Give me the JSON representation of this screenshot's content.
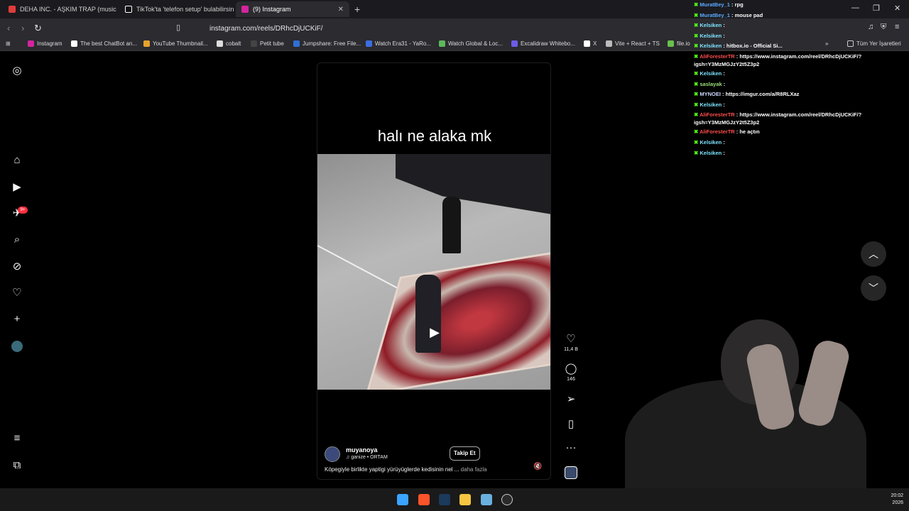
{
  "browser": {
    "tabs": [
      {
        "title": "DEHA INC. - AŞKIM TRAP (music vide",
        "color": "#e03c3c"
      },
      {
        "title": "TikTok'ta 'telefon setup' bulabilirsiniz",
        "color": "#ffffff"
      },
      {
        "title": "(9) Instagram",
        "color": "#d6249f",
        "active": true
      }
    ],
    "new_tab": "+",
    "url": "instagram.com/reels/DRhcDjUCKiF/",
    "bookmarks": [
      {
        "label": "Instagram",
        "color": "#d6249f"
      },
      {
        "label": "The best ChatBot an...",
        "color": "#ffffff"
      },
      {
        "label": "YouTube Thumbnail...",
        "color": "#e6a22d"
      },
      {
        "label": "cobalt",
        "color": "#ffffff"
      },
      {
        "label": "Petit tube",
        "color": "#444444"
      },
      {
        "label": "Jumpshare: Free File...",
        "color": "#2f6fd6"
      },
      {
        "label": "Watch Era31 - YaRo...",
        "color": "#3b6ee0"
      },
      {
        "label": "Watch Global & Loc...",
        "color": "#5cb85c"
      },
      {
        "label": "Excalidraw Whitebo...",
        "color": "#6c5ce7"
      },
      {
        "label": "X",
        "color": "#ffffff"
      },
      {
        "label": "Vite + React + TS",
        "color": "#bbbbbb"
      },
      {
        "label": "file.io",
        "color": "#6abf4b"
      }
    ],
    "all_bookmarks": "Tüm Yer İşaretleri"
  },
  "instagram": {
    "notification_badge": "9+",
    "reel": {
      "caption": "halı ne alaka mk",
      "username": "muyanoya",
      "music": "ganize • ORTAM",
      "follow_label": "Takip Et",
      "description": "Köpegiyle birlikte yaptigi yürüyüglerde kedisinin nel ...",
      "more_label": "daha fazla"
    },
    "likes": "11,4 B",
    "comments": "146"
  },
  "chat": [
    {
      "user": "MuratBey_1",
      "msg": "rpg",
      "color": "#5aa9ff"
    },
    {
      "user": "MuratBey_1",
      "msg": "mouse pad",
      "color": "#5aa9ff"
    },
    {
      "user": "Kelsiken",
      "msg": "",
      "color": "#7fe3ff"
    },
    {
      "user": "Kelsiken",
      "msg": "",
      "color": "#7fe3ff"
    },
    {
      "user": "Kelsiken",
      "msg": "hitbox.io - Official Si...",
      "color": "#7fe3ff"
    },
    {
      "user": "AliForesterTR",
      "msg": "https://www.instagram.com/reel/DRhcDjUCKiF/?igsh=Y3MzMGJzY2t5Z3p2",
      "color": "#ff4d4d",
      "wrap": true
    },
    {
      "user": "Kelsiken",
      "msg": "",
      "color": "#7fe3ff"
    },
    {
      "user": "saslayak",
      "msg": "",
      "color": "#9be07a"
    },
    {
      "user": "MYNOEI",
      "msg": "https://imgur.com/a/R8RLXaz",
      "color": "#cfd8ff"
    },
    {
      "user": "Kelsiken",
      "msg": "",
      "color": "#7fe3ff"
    },
    {
      "user": "AliForesterTR",
      "msg": "https://www.instagram.com/reel/DRhcDjUCKiF/?igsh=Y3MzMGJzY2t5Z3p2",
      "color": "#ff4d4d",
      "wrap": true
    },
    {
      "user": "AliForesterTR",
      "msg": "he açtın",
      "color": "#ff4d4d"
    },
    {
      "user": "Kelsiken",
      "msg": "",
      "color": "#7fe3ff"
    },
    {
      "user": "Kelsiken",
      "msg": "",
      "color": "#7fe3ff"
    }
  ],
  "taskbar": {
    "time": "20:02",
    "date": "2026"
  }
}
